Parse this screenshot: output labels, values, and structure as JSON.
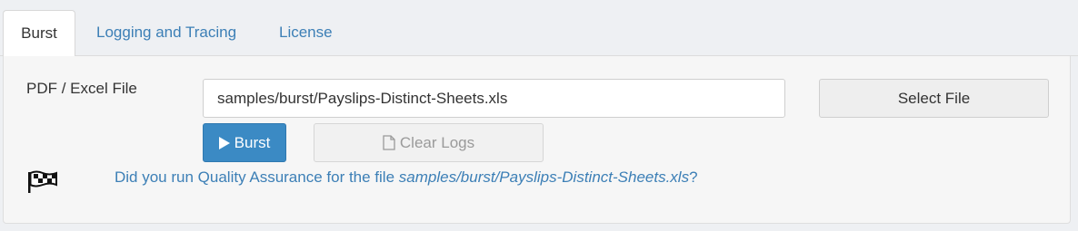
{
  "tabs": [
    {
      "label": "Burst",
      "active": true
    },
    {
      "label": "Logging and Tracing",
      "active": false
    },
    {
      "label": "License",
      "active": false
    }
  ],
  "form": {
    "file_label": "PDF / Excel File",
    "file_value": "samples/burst/Payslips-Distinct-Sheets.xls",
    "select_file_label": "Select File",
    "burst_label": "Burst",
    "clear_logs_label": "Clear Logs",
    "clear_logs_disabled": true
  },
  "qa_notice": {
    "icon": "checkered-flag-icon",
    "prefix": "Did you run Quality Assurance for the file ",
    "file": "samples/burst/Payslips-Distinct-Sheets.xls",
    "suffix": "?"
  },
  "colors": {
    "accent": "#3b8ac4",
    "link": "#3c7fb6",
    "background": "#eef0f3"
  }
}
